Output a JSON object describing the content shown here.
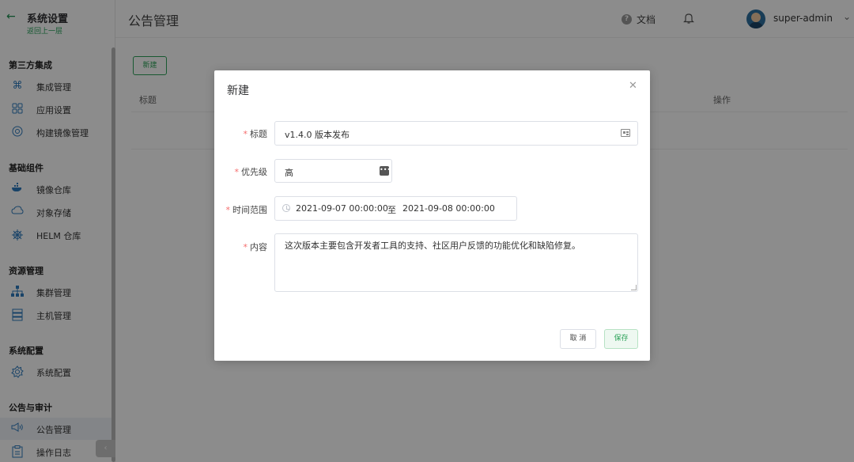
{
  "sidebar": {
    "title": "系统设置",
    "back_link": "返回上一层",
    "groups": [
      {
        "title": "第三方集成",
        "items": [
          {
            "label": "集成管理",
            "icon": "command-icon"
          },
          {
            "label": "应用设置",
            "icon": "grid-icon"
          },
          {
            "label": "构建镜像管理",
            "icon": "disc-icon"
          }
        ]
      },
      {
        "title": "基础组件",
        "items": [
          {
            "label": "镜像仓库",
            "icon": "docker-icon"
          },
          {
            "label": "对象存储",
            "icon": "cloud-icon"
          },
          {
            "label": "HELM 仓库",
            "icon": "helm-icon"
          }
        ]
      },
      {
        "title": "资源管理",
        "items": [
          {
            "label": "集群管理",
            "icon": "cluster-icon"
          },
          {
            "label": "主机管理",
            "icon": "server-icon"
          }
        ]
      },
      {
        "title": "系统配置",
        "items": [
          {
            "label": "系统配置",
            "icon": "settings-icon"
          }
        ]
      },
      {
        "title": "公告与审计",
        "items": [
          {
            "label": "公告管理",
            "icon": "megaphone-icon",
            "active": true
          },
          {
            "label": "操作日志",
            "icon": "log-icon"
          }
        ]
      }
    ]
  },
  "header": {
    "page_title": "公告管理",
    "docs_label": "文档",
    "username": "super-admin"
  },
  "content": {
    "new_button": "新建",
    "columns": {
      "title": "标题",
      "operations": "操作"
    }
  },
  "modal": {
    "title": "新建",
    "fields": {
      "title": {
        "label": "标题",
        "value": "v1.4.0 版本发布"
      },
      "priority": {
        "label": "优先级",
        "value": "高"
      },
      "time_range": {
        "label": "时间范围",
        "start": "2021-09-07 00:00:00",
        "separator": "至",
        "end": "2021-09-08 00:00:00"
      },
      "content": {
        "label": "内容",
        "value": "这次版本主要包含开发者工具的支持、社区用户反馈的功能优化和缺陷修复。"
      }
    },
    "required_mark": "*",
    "cancel_label": "取 消",
    "save_label": "保存"
  },
  "colors": {
    "accent": "#2ea35a",
    "required": "#f56c6c"
  }
}
